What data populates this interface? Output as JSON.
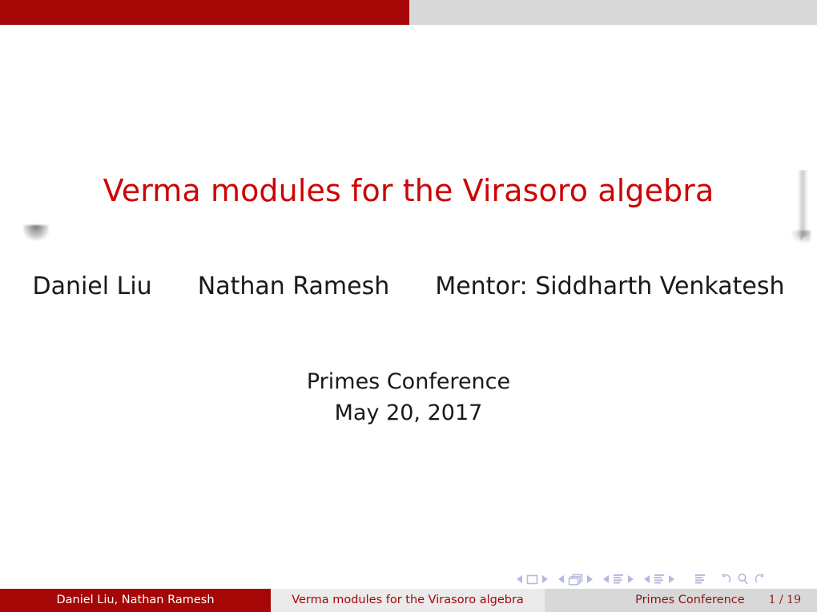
{
  "theme": {
    "primary_color": "#a50606",
    "title_color": "#cc0505",
    "header_gray": "#d8d8d8",
    "foot_light_gray": "#ebebeb",
    "foot_dark_gray": "#d8d8d8",
    "nav_symbol_color": "#b6b8de",
    "body_text_color": "#191919"
  },
  "header": {
    "left_block_label": "",
    "right_block_label": ""
  },
  "title": {
    "text": "Verma modules for the Virasoro algebra"
  },
  "authors": {
    "list": [
      "Daniel Liu",
      "Nathan Ramesh",
      "Mentor: Siddharth Venkatesh"
    ]
  },
  "meta": {
    "institute": "Primes Conference",
    "date": "May 20, 2017"
  },
  "navigation_symbols": {
    "groups": [
      {
        "prev": "◀",
        "icon": "slide-icon",
        "next": "▶"
      },
      {
        "prev": "◀",
        "icon": "frames-icon",
        "next": "▶"
      },
      {
        "prev": "◀",
        "icon": "subsection-icon",
        "next": "▶"
      },
      {
        "prev": "◀",
        "icon": "section-icon",
        "next": "▶"
      }
    ],
    "doc_icon": "document-icon",
    "tools": [
      "back-arrow-icon",
      "search-icon",
      "forward-arrow-icon"
    ]
  },
  "footline": {
    "author": "Daniel Liu, Nathan Ramesh",
    "title": "Verma modules for the Virasoro algebra",
    "institute": "Primes Conference",
    "page": "1 / 19"
  }
}
